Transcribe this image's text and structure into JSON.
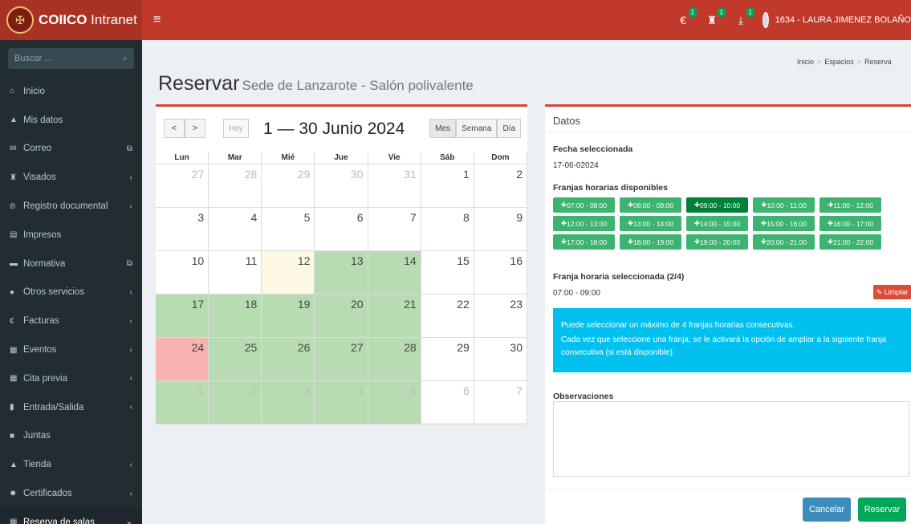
{
  "brand": {
    "name_bold": "COIICO",
    "name_light": " Intranet"
  },
  "topbar": {
    "menu_icon": "hamburger-icon",
    "badges": [
      "1",
      "1",
      "1"
    ],
    "user": "1634 - LAURA JIMENEZ BOLAÑO"
  },
  "sidebar": {
    "search_placeholder": "Buscar ...",
    "items": [
      {
        "label": "Inicio",
        "icon": "home-icon",
        "arrow": ""
      },
      {
        "label": "Mis datos",
        "icon": "user-icon",
        "arrow": ""
      },
      {
        "label": "Correo",
        "icon": "mail-icon",
        "arrow": "⧉"
      },
      {
        "label": "Visados",
        "icon": "stamp-icon",
        "arrow": "‹"
      },
      {
        "label": "Registro documental",
        "icon": "registered-icon",
        "arrow": "‹"
      },
      {
        "label": "Impresos",
        "icon": "document-icon",
        "arrow": ""
      },
      {
        "label": "Normativa",
        "icon": "book-icon",
        "arrow": "⧉"
      },
      {
        "label": "Otros servicios",
        "icon": "globe-icon",
        "arrow": "‹"
      },
      {
        "label": "Facturas",
        "icon": "euro-icon",
        "arrow": "‹"
      },
      {
        "label": "Eventos",
        "icon": "calendar-icon",
        "arrow": "‹"
      },
      {
        "label": "Cita previa",
        "icon": "calendar-icon",
        "arrow": "‹"
      },
      {
        "label": "Entrada/Salida",
        "icon": "file-icon",
        "arrow": "‹"
      },
      {
        "label": "Juntas",
        "icon": "video-icon",
        "arrow": ""
      },
      {
        "label": "Tienda",
        "icon": "shop-icon",
        "arrow": "‹"
      },
      {
        "label": "Certificados",
        "icon": "certificate-icon",
        "arrow": "‹"
      },
      {
        "label": "Reserva de salas",
        "icon": "calendar-icon",
        "arrow": "⌄"
      }
    ]
  },
  "breadcrumb": {
    "items": [
      "Inicio",
      "Espacios",
      "Reserva"
    ]
  },
  "page": {
    "title": "Reservar",
    "subtitle": "Sede de Lanzarote - Salón polivalente"
  },
  "calendar": {
    "today_label": "Hoy",
    "title": "1 — 30 Junio 2024",
    "views": [
      "Mes",
      "Semana",
      "Día"
    ],
    "days": [
      "Lun",
      "Mar",
      "Mié",
      "Jue",
      "Vie",
      "Sáb",
      "Dom"
    ],
    "weeks": [
      [
        {
          "d": "27",
          "s": "other"
        },
        {
          "d": "28",
          "s": "other"
        },
        {
          "d": "29",
          "s": "other"
        },
        {
          "d": "30",
          "s": "other"
        },
        {
          "d": "31",
          "s": "other"
        },
        {
          "d": "1",
          "s": ""
        },
        {
          "d": "2",
          "s": ""
        }
      ],
      [
        {
          "d": "3",
          "s": ""
        },
        {
          "d": "4",
          "s": ""
        },
        {
          "d": "5",
          "s": ""
        },
        {
          "d": "6",
          "s": ""
        },
        {
          "d": "7",
          "s": ""
        },
        {
          "d": "8",
          "s": ""
        },
        {
          "d": "9",
          "s": ""
        }
      ],
      [
        {
          "d": "10",
          "s": ""
        },
        {
          "d": "11",
          "s": ""
        },
        {
          "d": "12",
          "s": "today"
        },
        {
          "d": "13",
          "s": "green"
        },
        {
          "d": "14",
          "s": "green"
        },
        {
          "d": "15",
          "s": ""
        },
        {
          "d": "16",
          "s": ""
        }
      ],
      [
        {
          "d": "17",
          "s": "green"
        },
        {
          "d": "18",
          "s": "green"
        },
        {
          "d": "19",
          "s": "green"
        },
        {
          "d": "20",
          "s": "green"
        },
        {
          "d": "21",
          "s": "green"
        },
        {
          "d": "22",
          "s": ""
        },
        {
          "d": "23",
          "s": ""
        }
      ],
      [
        {
          "d": "24",
          "s": "red"
        },
        {
          "d": "25",
          "s": "green"
        },
        {
          "d": "26",
          "s": "green"
        },
        {
          "d": "27",
          "s": "green"
        },
        {
          "d": "28",
          "s": "green"
        },
        {
          "d": "29",
          "s": ""
        },
        {
          "d": "30",
          "s": ""
        }
      ],
      [
        {
          "d": "1",
          "s": "green other"
        },
        {
          "d": "2",
          "s": "green other"
        },
        {
          "d": "3",
          "s": "green other"
        },
        {
          "d": "4",
          "s": "green other"
        },
        {
          "d": "5",
          "s": "green other"
        },
        {
          "d": "6",
          "s": "other"
        },
        {
          "d": "7",
          "s": "other"
        }
      ]
    ]
  },
  "datos": {
    "title": "Datos",
    "fecha_label": "Fecha seleccionada",
    "fecha_value": "17-06-02024",
    "franjas_label": "Franjas horarias disponibles",
    "slots": [
      "07:00 - 08:00",
      "08:00 - 09:00",
      "09:00 - 10:00",
      "10:00 - 11:00",
      "11:00 - 12:00",
      "12:00 - 13:00",
      "13:00 - 14:00",
      "14:00 - 15:00",
      "15:00 - 16:00",
      "16:00 - 17:00",
      "17:00 - 18:00",
      "18:00 - 19:00",
      "19:00 - 20:00",
      "20:00 - 21:00",
      "21:00 - 22:00"
    ],
    "selected_slot_index": 2,
    "franja_sel_label": "Franja horaria seleccionada (2/4)",
    "franja_sel_value": "07:00 - 09:00",
    "limpiar": "Limpiar",
    "info_line1": "Puede seleccionar un máximo de 4 franjas horarias consecutivas.",
    "info_line2": "Cada vez que seleccione una franja, se le activará la opción de ampliar a la siguiente franja consecutiva (si está disponible).",
    "obs_label": "Observaciones",
    "cancel": "Cancelar",
    "reserve": "Reservar"
  },
  "colors": {
    "header": "#c0392b",
    "sidebar": "#222d32",
    "green_day": "#b8dcb2",
    "red_day": "#f7b2b1",
    "slot": "#3cb371"
  }
}
